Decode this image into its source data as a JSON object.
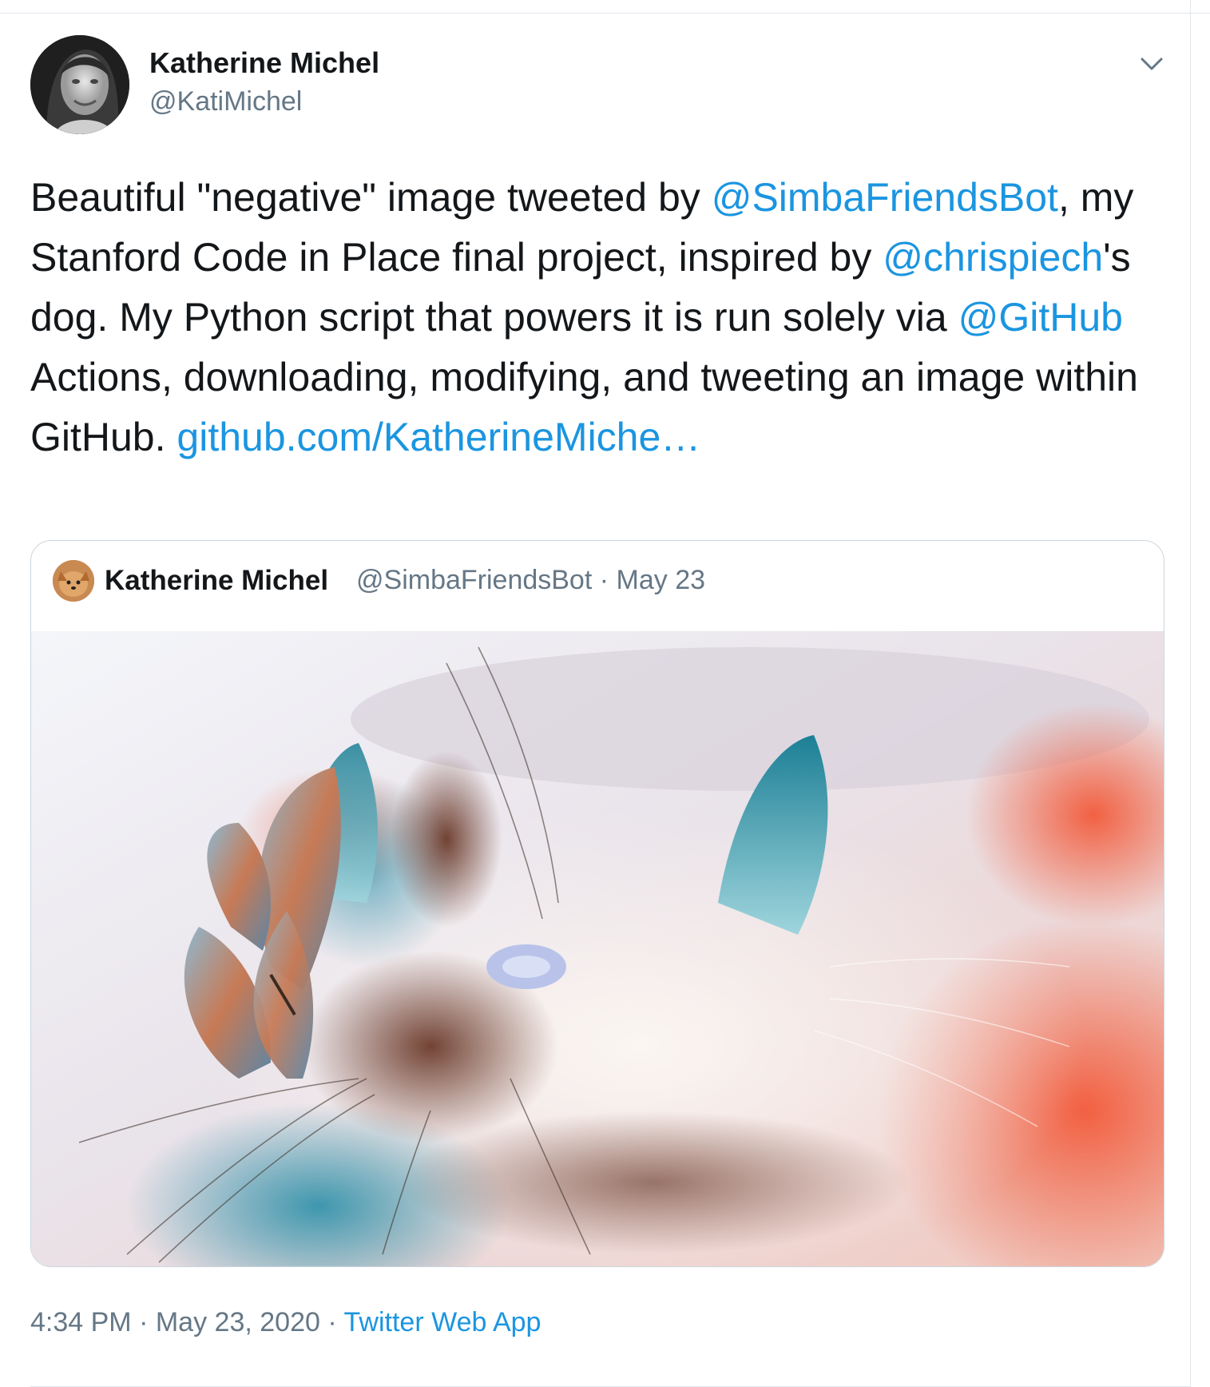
{
  "author": {
    "name": "Katherine Michel",
    "handle": "@KatiMichel",
    "avatar_icon": "profile-photo"
  },
  "menu": {
    "icon": "chevron-down-icon"
  },
  "tweet": {
    "t1": "Beautiful \"negative\" image tweeted by ",
    "m1": "@SimbaFriendsBot",
    "t2": ", my Stanford Code in Place final project, inspired by ",
    "m2": "@chrispiech",
    "t3": "'s dog. My Python script that powers it is run solely via ",
    "m3": "@GitHub",
    "t4": " Actions, downloading, modifying, and tweeting an image within GitHub. ",
    "url": "github.com/KatherineMiche…"
  },
  "quoted": {
    "name": "Katherine Michel",
    "handle": "@SimbaFriendsBot",
    "separator": "·",
    "date": "May 23",
    "image_description_icon": "inverted-cat-with-butterfly-image"
  },
  "footer": {
    "time": "4:34 PM",
    "separator": "·",
    "date": "May 23, 2020",
    "app": "Twitter Web App"
  },
  "colors": {
    "link": "#1b95e0",
    "secondary_text": "#657786",
    "border": "#ccd6dd"
  }
}
